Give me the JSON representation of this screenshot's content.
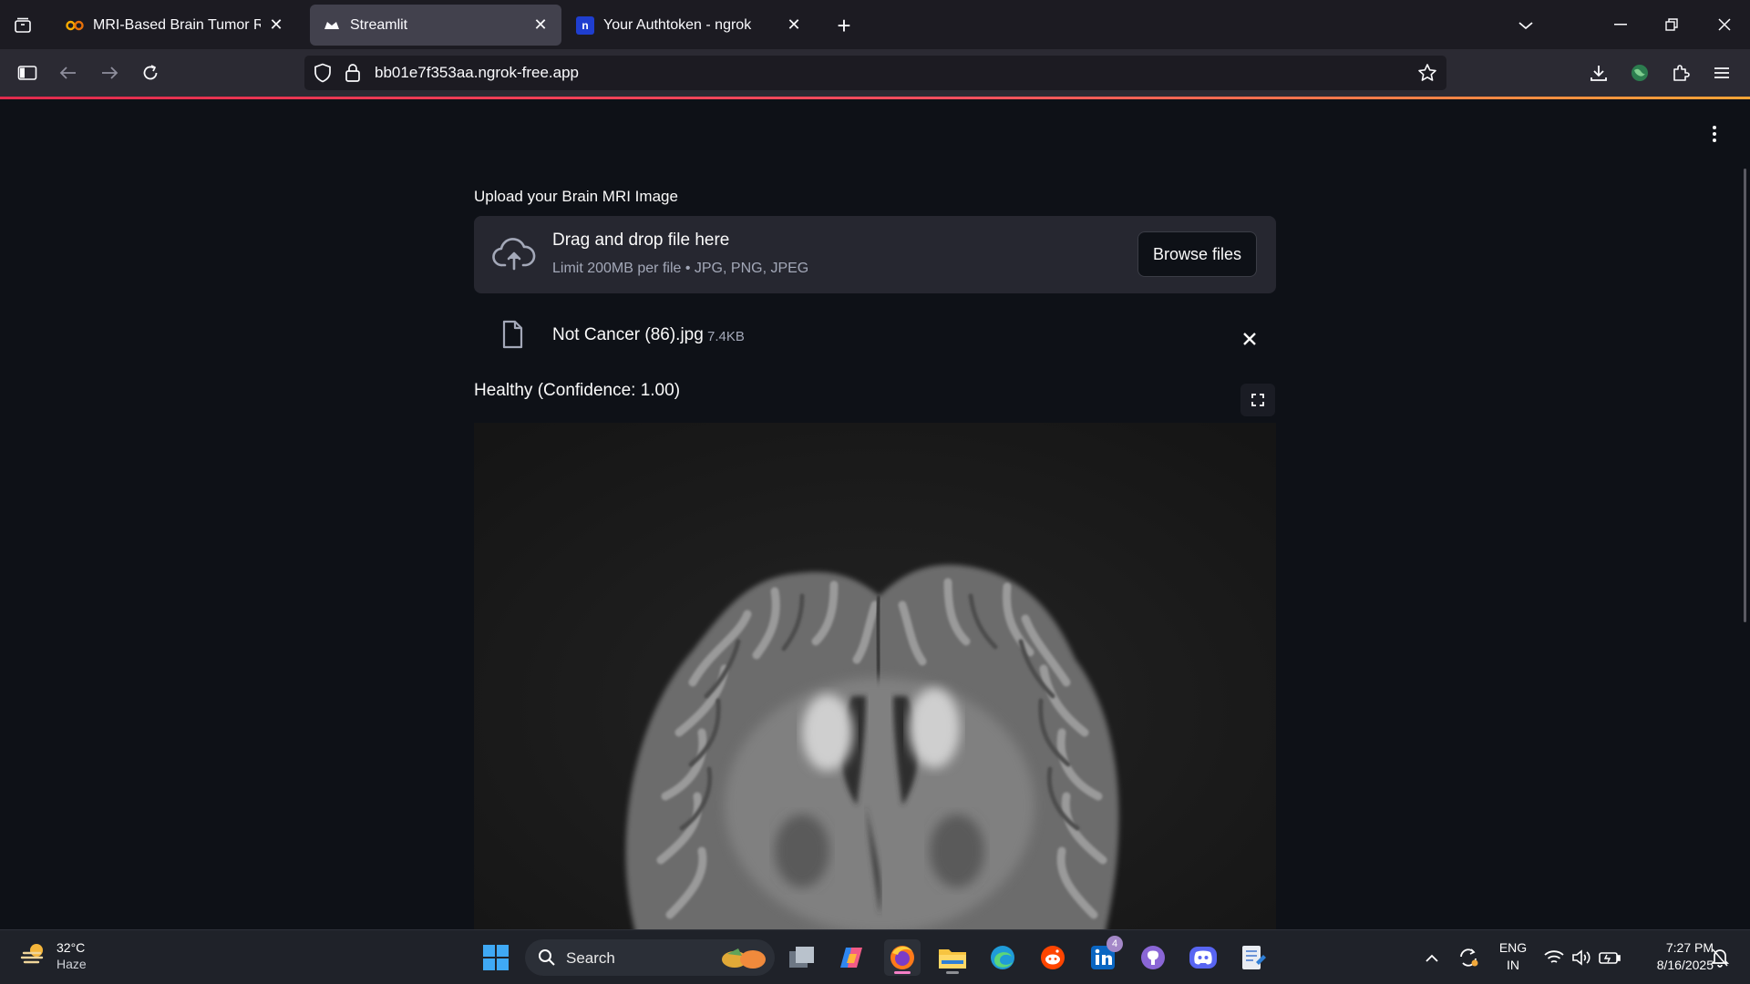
{
  "browser": {
    "tabs": [
      {
        "title": "MRI-Based Brain Tumor Recogn",
        "favicon": "colab-icon"
      },
      {
        "title": "Streamlit",
        "favicon": "streamlit-icon"
      },
      {
        "title": "Your Authtoken - ngrok",
        "favicon": "ngrok-icon"
      }
    ],
    "new_tab": "+",
    "url": "bb01e7f353aa.ngrok-free.app"
  },
  "app": {
    "uploader": {
      "label": "Upload your Brain MRI Image",
      "drop_title": "Drag and drop file here",
      "drop_hint": "Limit 200MB per file • JPG, PNG, JPEG",
      "browse_label": "Browse files"
    },
    "file": {
      "name": "Not Cancer (86).jpg",
      "size": "7.4KB"
    },
    "result_text": "Healthy (Confidence: 1.00)"
  },
  "taskbar": {
    "weather": {
      "temp": "32°C",
      "condition": "Haze"
    },
    "search_label": "Search",
    "linkedin_badge": "4",
    "lang": {
      "line1": "ENG",
      "line2": "IN"
    },
    "clock": {
      "time": "7:27 PM",
      "date": "8/16/2025"
    }
  },
  "colors": {
    "page_bg": "#0e1117",
    "dropzone_bg": "#262730",
    "secondary_text": "#a3a8b8",
    "active_tab": "#42414d"
  }
}
